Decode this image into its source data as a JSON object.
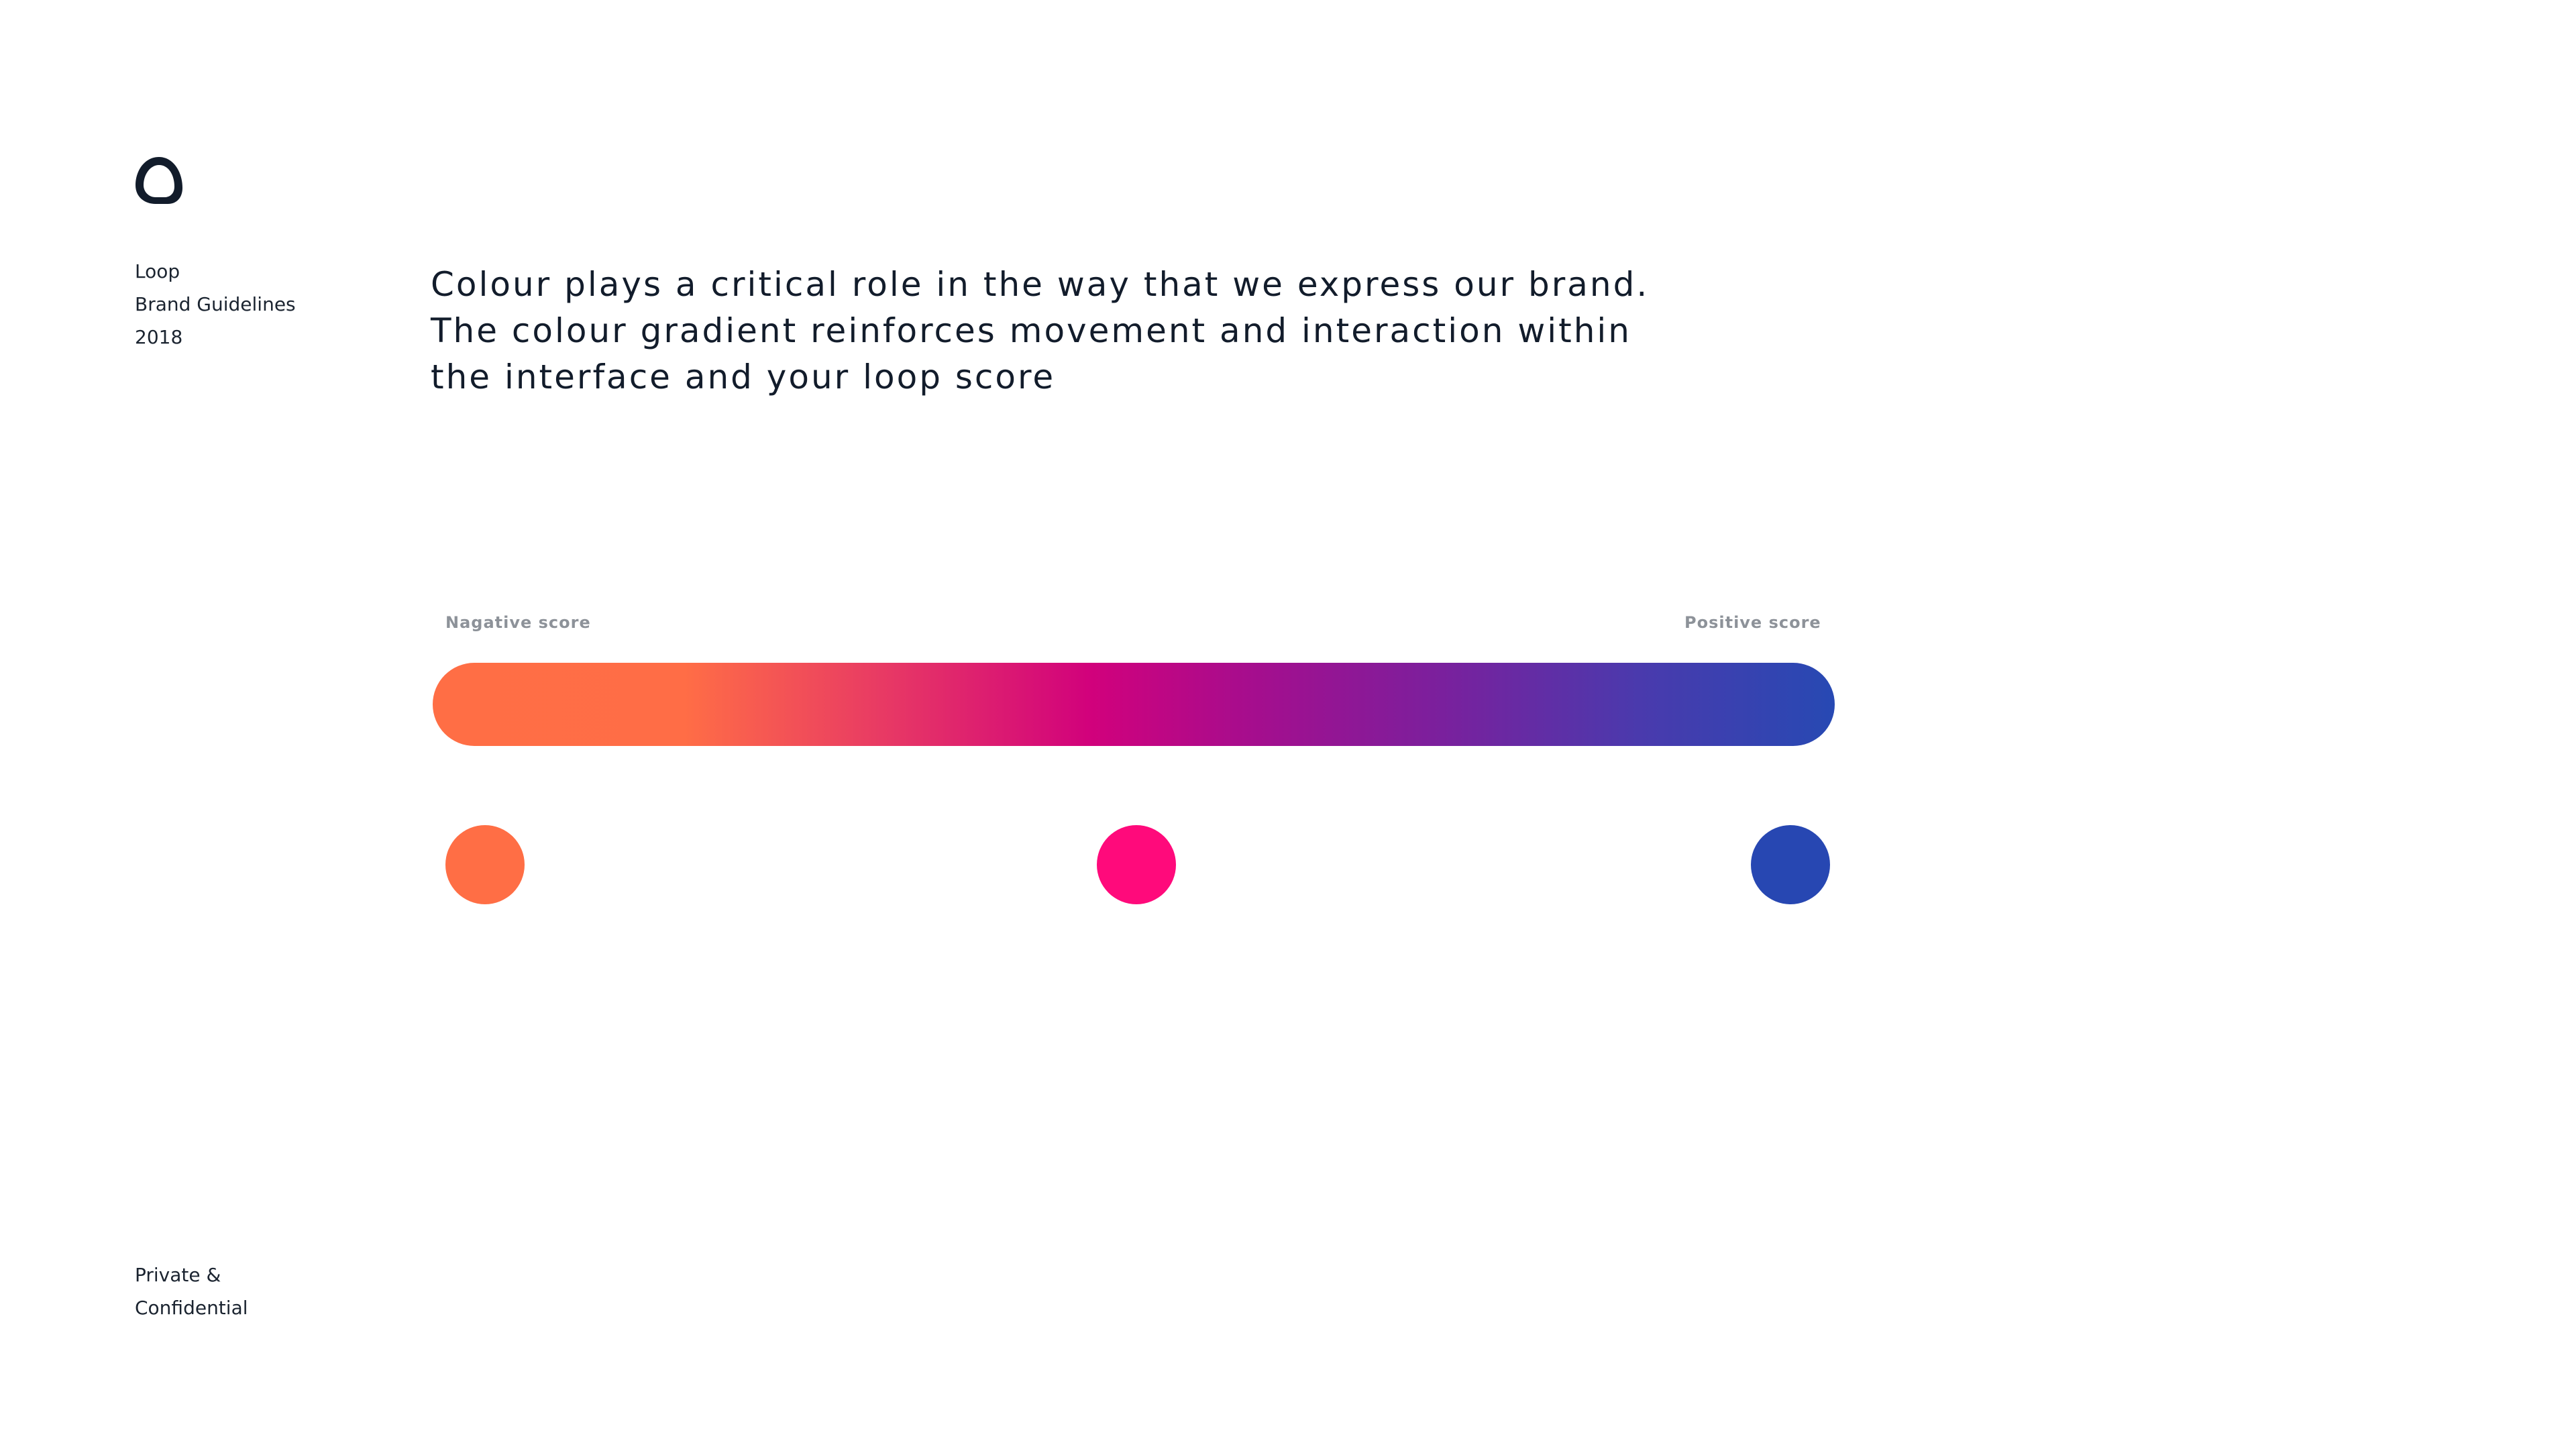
{
  "brand": {
    "logo_icon": "loop-logo-icon",
    "name": "Loop",
    "doc_title": "Brand Guidelines",
    "year": "2018"
  },
  "intro": {
    "lines": [
      "Colour plays a critical role in the way that we express our brand.",
      "The colour gradient reinforces movement and interaction within",
      "the interface and your loop score"
    ]
  },
  "score_scale": {
    "negative_label": "Nagative score",
    "positive_label": "Positive score",
    "gradient_colors": [
      "#ff6e45",
      "#d1017c",
      "#7a209d",
      "#2749b3"
    ]
  },
  "swatches": [
    {
      "name": "orange",
      "color": "#ff6e45"
    },
    {
      "name": "pink",
      "color": "#ff0a7b"
    },
    {
      "name": "blue",
      "color": "#2747b2"
    }
  ],
  "footer": {
    "line1": "Private &",
    "line2": "Confidential"
  }
}
